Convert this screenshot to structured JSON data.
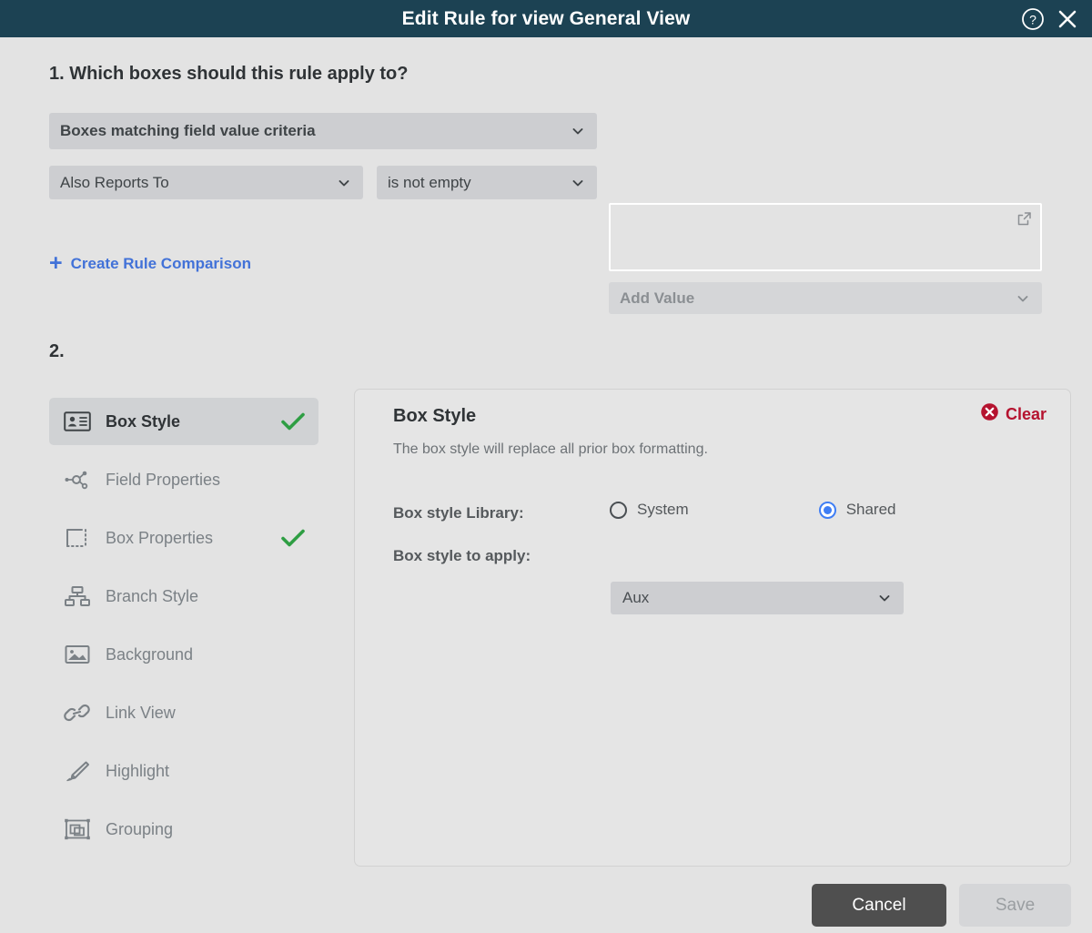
{
  "titlebar": {
    "title": "Edit Rule for view General View",
    "help_icon": "question-circle-icon",
    "close_icon": "close-icon"
  },
  "section1": {
    "heading": "1. Which boxes should this rule apply to?",
    "scope_select": {
      "value": "Boxes matching field value criteria"
    },
    "field_select": {
      "value": "Also Reports To"
    },
    "operator_select": {
      "value": "is not empty"
    },
    "create_comparison": {
      "plus": "+",
      "label": "Create Rule Comparison"
    },
    "value_box": {
      "value": "",
      "expand_icon": "open-external-icon"
    },
    "add_value_select": {
      "value": "Add Value"
    }
  },
  "section2": {
    "heading": "2.",
    "nav_items": [
      {
        "label": "Box Style",
        "icon": "id-card-icon",
        "active": true,
        "checked": true
      },
      {
        "label": "Field Properties",
        "icon": "node-graph-icon",
        "active": false,
        "checked": false
      },
      {
        "label": "Box Properties",
        "icon": "dashed-box-icon",
        "active": false,
        "checked": true
      },
      {
        "label": "Branch Style",
        "icon": "org-chart-icon",
        "active": false,
        "checked": false
      },
      {
        "label": "Background",
        "icon": "image-icon",
        "active": false,
        "checked": false
      },
      {
        "label": "Link View",
        "icon": "link-icon",
        "active": false,
        "checked": false
      },
      {
        "label": "Highlight",
        "icon": "highlighter-icon",
        "active": false,
        "checked": false
      },
      {
        "label": "Grouping",
        "icon": "grouping-icon",
        "active": false,
        "checked": false
      }
    ],
    "panel": {
      "title": "Box Style",
      "description": "The box style will replace all prior box formatting.",
      "clear_label": "Clear",
      "clear_icon": "error-circle-icon",
      "library_label": "Box style Library:",
      "library_options": [
        {
          "label": "System",
          "selected": false
        },
        {
          "label": "Shared",
          "selected": true
        }
      ],
      "apply_label": "Box style to apply:",
      "apply_select": {
        "value": "Aux"
      }
    }
  },
  "footer": {
    "cancel_label": "Cancel",
    "save_label": "Save"
  },
  "colors": {
    "titlebar": "#1c4253",
    "background": "#e3e3e3",
    "control": "#cdced1",
    "link": "#4272d8",
    "check_green": "#2e9e43",
    "clear_red": "#b5132f",
    "radio_blue": "#3f7ef4",
    "cancel_dark": "#4f4f4f"
  }
}
